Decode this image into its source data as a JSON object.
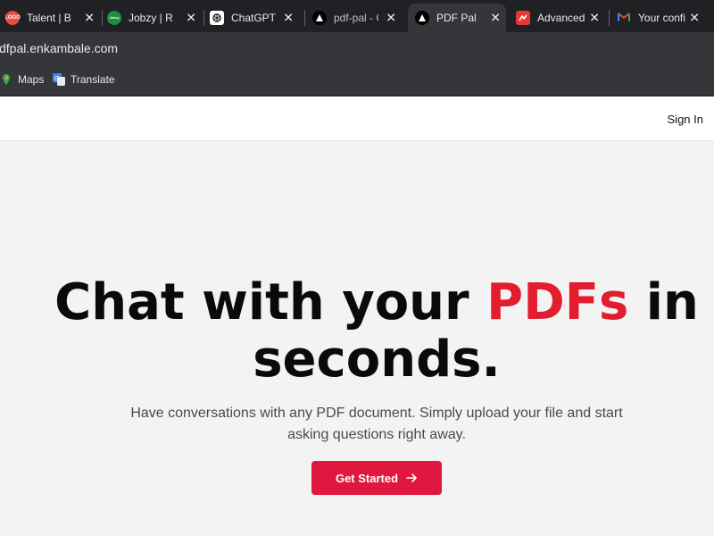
{
  "tabs": [
    {
      "title": "Talent | Bac",
      "favicon_color": "#e74c3c",
      "favicon_text": "LOGO"
    },
    {
      "title": "Jobzy | Rea",
      "favicon_color": "#1e8e3e",
      "favicon_text": "Jobzy"
    },
    {
      "title": "ChatGPT",
      "favicon_color": "#ffffff",
      "favicon_text": ""
    },
    {
      "title": "pdf-pal - C",
      "favicon_color": "#000000",
      "favicon_text": ""
    },
    {
      "title": "PDF Pal",
      "favicon_color": "#000000",
      "favicon_text": "",
      "active": true
    },
    {
      "title": "Advanced",
      "favicon_color": "#e53935",
      "favicon_text": ""
    },
    {
      "title": "Your confi",
      "favicon_color": "#ffffff",
      "favicon_text": "M"
    }
  ],
  "address": {
    "url": "dfpal.enkambale.com"
  },
  "bookmarks": [
    {
      "label": "Maps"
    },
    {
      "label": "Translate"
    }
  ],
  "header": {
    "signin_label": "Sign In"
  },
  "hero": {
    "headline_part1": "Chat with your ",
    "headline_accent": "PDFs",
    "headline_part2": " in",
    "headline_line2": "seconds.",
    "subtitle_line1": "Have conversations with any PDF document. Simply upload your file and start",
    "subtitle_line2": "asking questions right away.",
    "cta_label": "Get Started"
  },
  "colors": {
    "accent": "#e11d2e",
    "button": "#e0173f"
  }
}
